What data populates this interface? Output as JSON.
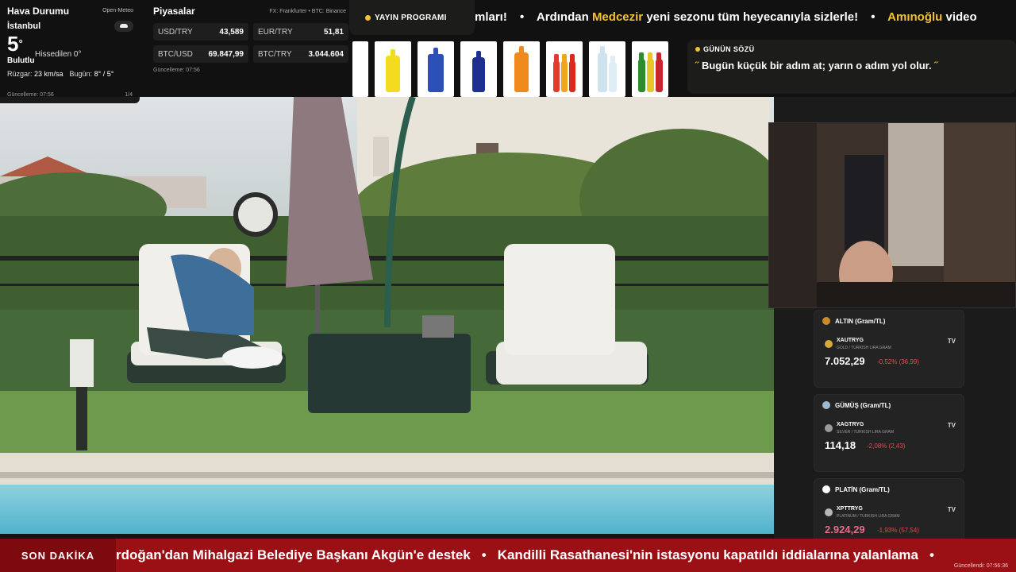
{
  "weather": {
    "title": "Hava Durumu",
    "source": "Open-Meteo",
    "city": "İstanbul",
    "temp": "5",
    "temp_unit": "°",
    "feels_like": "Hissedilen 0°",
    "condition": "Bulutlu",
    "wind_label": "Rüzgar:",
    "wind_value": "23 km/sa",
    "today_label": "Bugün:",
    "today_value": "8° / 5°",
    "updated": "Güncelleme: 07:56",
    "page": "1/4",
    "icon": "cloud-icon"
  },
  "markets": {
    "title": "Piyasalar",
    "source": "FX: Frankfurter • BTC: Binance",
    "rates": [
      {
        "symbol": "USD/TRY",
        "value": "43,589"
      },
      {
        "symbol": "EUR/TRY",
        "value": "51,81"
      },
      {
        "symbol": "BTC/USD",
        "value": "69.847,99"
      },
      {
        "symbol": "BTC/TRY",
        "value": "3.044.604"
      }
    ],
    "updated": "Güncelleme: 07:56"
  },
  "schedule": {
    "label": "YAYIN PROGRAMI",
    "accent": "#f1c232"
  },
  "ticker_top": {
    "p1": "mları!",
    "p2": "Ardından",
    "p2_hl": "Medcezir",
    "p3": "yeni sezonu tüm heyecanıyla sizlerle!",
    "p4_hl": "Amınoğlu",
    "p4": "video"
  },
  "quote": {
    "heading": "GÜNÜN SÖZÜ",
    "text": "Bugün küçük bir adım at; yarın o adım yol olur.",
    "open_mark": "˝",
    "close_mark": "˝"
  },
  "metals": [
    {
      "title": "ALTIN (Gram/TL)",
      "symbol": "XAUTRYG",
      "desc": "GOLD / TURKISH LIRA GRAM",
      "price": "7.052,29",
      "change": "-0,52% (36,99)",
      "medal": "#c98a2a",
      "coin": "#d6a93a"
    },
    {
      "title": "GÜMÜŞ (Gram/TL)",
      "symbol": "XAGTRYG",
      "desc": "SILVER / TURKISH LIRA GRAM",
      "price": "114,18",
      "change": "-2,08% (2,43)",
      "medal": "#9fb8cf",
      "coin": "#9a9a9a"
    },
    {
      "title": "PLATİN (Gram/TL)",
      "symbol": "XPTTRYG",
      "desc": "PLATINUM / TURKISH LIRA GRAM",
      "price": "2.924,29",
      "change": "-1,93% (57,54)",
      "medal": "#ffffff",
      "coin": "#b8b8b8"
    }
  ],
  "metal_tv_label": "TV",
  "breaking": {
    "label": "SON DAKİKA",
    "item1": "rdoğan'dan Mihalgazi Belediye Başkanı Akgün'e destek",
    "separator": "•",
    "item2": "Kandilli Rasathanesi'nin istasyonu kapatıldı iddialarına yalanlama",
    "updated": "Güncellendi: 07:56:36",
    "color": "#9a1014"
  },
  "colors": {
    "accent": "#f1c232",
    "negative": "#e04e4e"
  }
}
